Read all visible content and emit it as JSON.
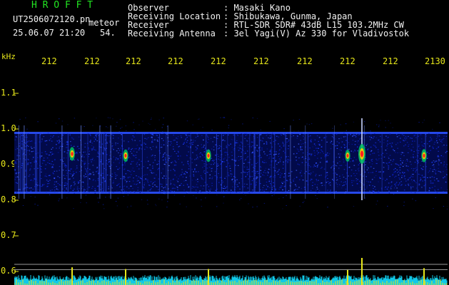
{
  "header": {
    "brand": "H R O F F T",
    "filename": "UT2506072120.pn",
    "meteor_label": "meteor",
    "datetime": "25.06.07 21:20",
    "count": "54.",
    "fields": [
      {
        "key": "Observer",
        "value": ": Masaki Kano"
      },
      {
        "key": "Receiving Location",
        "value": ": Shibukawa, Gunma, Japan"
      },
      {
        "key": "Receiver",
        "value": ": RTL-SDR SDR# 43dB L15 103.2MHz CW"
      },
      {
        "key": "Receiving Antenna",
        "value": ": 3el Yagi(V) Az 330 for Vladivostok"
      }
    ]
  },
  "chart_data": {
    "type": "heatmap",
    "ylabel": "kHz",
    "x_ticks": [
      "212",
      "212",
      "212",
      "212",
      "212",
      "212",
      "212",
      "212",
      "212",
      "2130"
    ],
    "y_ticks": [
      "1.1",
      "1.0",
      "0.9",
      "0.8",
      "0.7",
      "0.6"
    ],
    "y_tick_values": [
      1.1,
      1.0,
      0.9,
      0.8,
      0.7,
      0.6
    ],
    "ylim": [
      0.585,
      1.17
    ],
    "band": {
      "low": 0.82,
      "high": 0.99
    },
    "background_color": "#000000",
    "band_color": "#0a1cc8",
    "tick_color": "#e6e61a",
    "meteor_echoes": [
      {
        "time_index": 0,
        "freq_khz": 0.93,
        "strength": 0.45
      },
      {
        "time_index": 1,
        "freq_khz": 0.925,
        "strength": 0.35
      },
      {
        "time_index": 2,
        "freq_khz": 0.925,
        "strength": 0.35
      },
      {
        "time_index": 3,
        "freq_khz": 0.925,
        "strength": 0.3
      },
      {
        "time_index": 4,
        "freq_khz": 0.93,
        "strength": 1.0
      },
      {
        "time_index": 5,
        "freq_khz": 0.925,
        "strength": 0.4
      }
    ]
  }
}
